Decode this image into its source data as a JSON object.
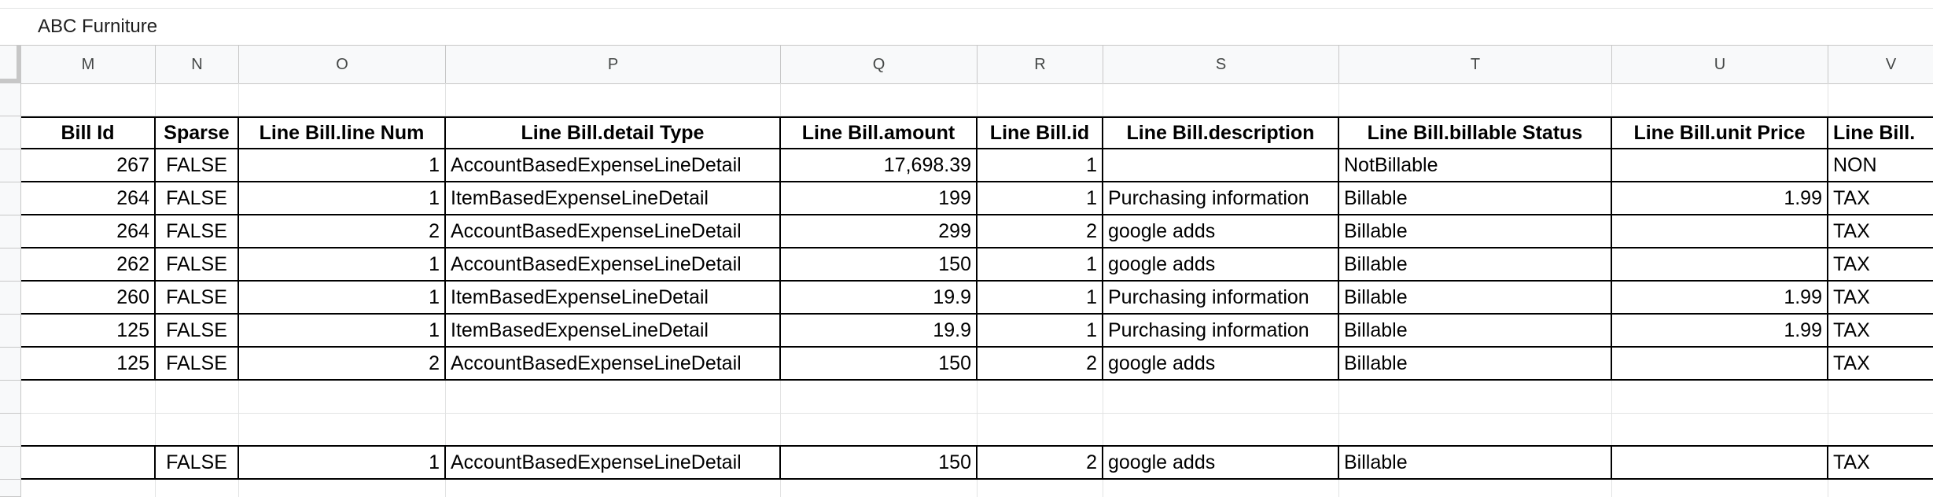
{
  "formula_bar": {
    "value": "ABC Furniture"
  },
  "columns": [
    "M",
    "N",
    "O",
    "P",
    "Q",
    "R",
    "S",
    "T",
    "U",
    "V"
  ],
  "table": {
    "headers": [
      "Bill Id",
      "Sparse",
      "Line Bill.line Num",
      "Line Bill.detail Type",
      "Line Bill.amount",
      "Line Bill.id",
      "Line Bill.description",
      "Line Bill.billable Status",
      "Line Bill.unit Price",
      "Line Bill."
    ],
    "rows": [
      [
        "267",
        "FALSE",
        "1",
        "AccountBasedExpenseLineDetail",
        "17,698.39",
        "1",
        "",
        "NotBillable",
        "",
        "NON"
      ],
      [
        "264",
        "FALSE",
        "1",
        "ItemBasedExpenseLineDetail",
        "199",
        "1",
        "Purchasing information",
        "Billable",
        "1.99",
        "TAX"
      ],
      [
        "264",
        "FALSE",
        "2",
        "AccountBasedExpenseLineDetail",
        "299",
        "2",
        "google adds",
        "Billable",
        "",
        "TAX"
      ],
      [
        "262",
        "FALSE",
        "1",
        "AccountBasedExpenseLineDetail",
        "150",
        "1",
        "google adds",
        "Billable",
        "",
        "TAX"
      ],
      [
        "260",
        "FALSE",
        "1",
        "ItemBasedExpenseLineDetail",
        "19.9",
        "1",
        "Purchasing information",
        "Billable",
        "1.99",
        "TAX"
      ],
      [
        "125",
        "FALSE",
        "1",
        "ItemBasedExpenseLineDetail",
        "19.9",
        "1",
        "Purchasing information",
        "Billable",
        "1.99",
        "TAX"
      ],
      [
        "125",
        "FALSE",
        "2",
        "AccountBasedExpenseLineDetail",
        "150",
        "2",
        "google adds",
        "Billable",
        "",
        "TAX"
      ]
    ],
    "footer_row": [
      "",
      "FALSE",
      "1",
      "AccountBasedExpenseLineDetail",
      "150",
      "2",
      "google adds",
      "Billable",
      "",
      "TAX"
    ]
  }
}
